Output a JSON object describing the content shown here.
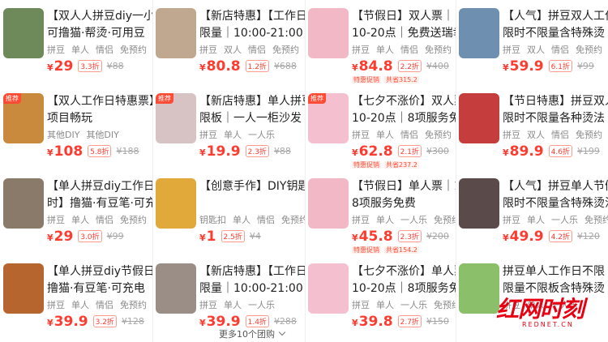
{
  "columns": [
    {
      "cards": [
        {
          "title1": "【双人人拼豆diy一小",
          "title2": "可撸猫·帮烫·可用豆",
          "tags": [
            "拼豆",
            "单人",
            "情侣",
            "免预约"
          ],
          "price": "29",
          "discount": "3.3折",
          "orig": "¥88",
          "thumb": "#6e8a5a",
          "thumbTag": ""
        },
        {
          "title1": "【双人工作日特惠票】",
          "title2": "项目畅玩",
          "tags": [
            "其他DIY",
            "其他DIY"
          ],
          "price": "108",
          "discount": "5.8折",
          "orig": "¥188",
          "thumb": "#c98a3e",
          "thumbTag": "推荐"
        },
        {
          "title1": "【单人拼豆diy工作日",
          "title2": "时】撸猫·有豆笔·可充",
          "tags": [
            "拼豆",
            "单人",
            "情侣",
            "免预约"
          ],
          "price": "29",
          "discount": "3.0折",
          "orig": "¥99",
          "thumb": "#8a7a6a",
          "thumbTag": ""
        },
        {
          "title1": "【单人拼豆diy节假日",
          "title2": "撸猫·有豆笔·可充电",
          "tags": [
            "拼豆",
            "单人",
            "情侣",
            "免预约"
          ],
          "price": "39.9",
          "discount": "3.2折",
          "orig": "¥128",
          "thumb": "#b7652f",
          "thumbTag": ""
        }
      ]
    },
    {
      "cards": [
        {
          "title1": "【新店特惠】【工作日",
          "title2": "限量｜10:00-21:00",
          "tags": [
            "拼豆",
            "双人",
            "情侣",
            "免预约"
          ],
          "price": "80.8",
          "discount": "1.2折",
          "orig": "¥688",
          "thumb": "#c0a890",
          "thumbTag": ""
        },
        {
          "title1": "【新店特惠】单人拼豆",
          "title2": "限板｜一人一柜沙发",
          "tags": [
            "拼豆",
            "单人",
            "一人乐"
          ],
          "price": "19.9",
          "discount": "2.3折",
          "orig": "¥88",
          "thumb": "#d7c2c4",
          "thumbTag": "推荐"
        },
        {
          "title1": "【创意手作】DIY钥匙",
          "title2": "",
          "tags": [
            "钥匙扣",
            "单人",
            "情侣",
            "免预约"
          ],
          "price": "1",
          "discount": "2.5折",
          "orig": "¥4",
          "thumb": "#e0a93a",
          "thumbTag": ""
        },
        {
          "title1": "【新店特惠】【工作日",
          "title2": "限量｜10:00-21:00",
          "tags": [
            "拼豆",
            "单人",
            "一人乐"
          ],
          "price": "39.9",
          "discount": "1.4折",
          "orig": "¥288",
          "thumb": "#9a8e86",
          "thumbTag": ""
        }
      ]
    },
    {
      "cards": [
        {
          "title1": "【节假日】双人票｜",
          "title2": "10-20点｜免费送瑞幸...",
          "tags": [
            "拼豆",
            "单人",
            "情侣",
            "免预约"
          ],
          "price": "84.8",
          "discount": "2.2折",
          "orig": "¥400",
          "thumb": "#f2b8c6",
          "thumbTag": "",
          "promo1": "特惠促销",
          "promo2": "共省315.2"
        },
        {
          "title1": "【七夕不涨价】双人票｜",
          "title2": "10-20点｜8项服务免费",
          "tags": [
            "拼豆",
            "单人",
            "情侣",
            "免预约"
          ],
          "price": "62.8",
          "discount": "2.1折",
          "orig": "¥300",
          "thumb": "#f4c0cf",
          "thumbTag": "推荐",
          "promo1": "特惠促销",
          "promo2": "共省237.2"
        },
        {
          "title1": "【节假日】单人票｜10-20",
          "title2": "8项服务免费",
          "tags": [
            "拼豆",
            "单人",
            "一人乐",
            "免预约"
          ],
          "price": "45.8",
          "discount": "2.3折",
          "orig": "¥200",
          "thumb": "#f2b8c6",
          "thumbTag": "",
          "promo1": "特惠促销",
          "promo2": "共省154.2"
        },
        {
          "title1": "【七夕不涨价】单人票｜",
          "title2": "10-20点｜8项服务免费",
          "tags": [
            "拼豆",
            "单人",
            "一人乐",
            "免预约"
          ],
          "price": "39.8",
          "discount": "2.7折",
          "orig": "¥150",
          "thumb": "#f4c0cf",
          "thumbTag": ""
        }
      ]
    },
    {
      "cards": [
        {
          "title1": "【人气】拼豆双人工作",
          "title2": "限时不限量含特殊烫",
          "tags": [
            "拼豆",
            "双人",
            "情侣",
            "免预约"
          ],
          "price": "59.9",
          "discount": "6.1折",
          "orig": "¥99",
          "thumb": "#6f8fb0",
          "thumbTag": ""
        },
        {
          "title1": "【节日特惠】拼豆双人",
          "title2": "限时不限量各种烫法",
          "tags": [
            "拼豆",
            "双人",
            "情侣",
            "免预约"
          ],
          "price": "89.9",
          "discount": "4.6折",
          "orig": "¥199",
          "thumb": "#c63d3d",
          "thumbTag": ""
        },
        {
          "title1": "【人气】拼豆单人节假",
          "title2": "限时不限量含特殊烫法",
          "tags": [
            "拼豆",
            "单人",
            "一人乐",
            "免预约"
          ],
          "price": "49.9",
          "discount": "4.2折",
          "orig": "¥120",
          "thumb": "#5a4a4a",
          "thumbTag": ""
        },
        {
          "title1": "拼豆单人工作日不限",
          "title2": "限量不限板含特殊烫",
          "tags": [
            "拼豆",
            "单人",
            "一人乐"
          ],
          "price": "",
          "discount": "",
          "orig": "",
          "thumb": "#8bbf6a",
          "thumbTag": ""
        }
      ]
    }
  ],
  "more_label": "更多10个团购",
  "watermark": "红网时刻",
  "watermark_sub": "REDNET.CN",
  "colors": {
    "accent": "#ff3b2f"
  }
}
